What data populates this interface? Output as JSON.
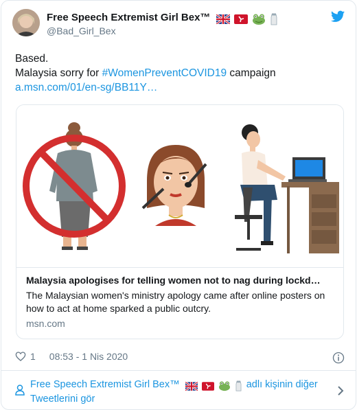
{
  "author": {
    "display_name": "Free Speech Extremist Girl Bex™",
    "handle": "@Bad_Girl_Bex"
  },
  "tweet": {
    "line1": "Based.",
    "line2_prefix": "Malaysia sorry for ",
    "hashtag": "#WomenPreventCOVID19",
    "line2_suffix": " campaign",
    "link": "a.msn.com/01/en-sg/BB11Y…"
  },
  "card": {
    "title": "Malaysia apologises for telling women not to nag during lockd…",
    "description": "The Malaysian women's ministry apology came after online posters on how to act at home sparked a public outcry.",
    "domain": "msn.com"
  },
  "meta": {
    "likes": "1",
    "timestamp": "08:53 - 1 Nis 2020"
  },
  "footer": {
    "name": "Free Speech Extremist Girl Bex™",
    "suffix": "adlı kişinin diğer Tweetlerini gör"
  },
  "colors": {
    "link": "#1b95e0",
    "secondary": "#657786",
    "border": "#e1e8ed",
    "prohibited": "#d32f2f"
  },
  "icons": [
    "twitter-bird-icon",
    "uk-flag-icon",
    "isle-of-man-flag-icon",
    "frog-icon",
    "salt-shaker-icon",
    "heart-icon",
    "info-icon",
    "person-icon",
    "chevron-right-icon"
  ]
}
